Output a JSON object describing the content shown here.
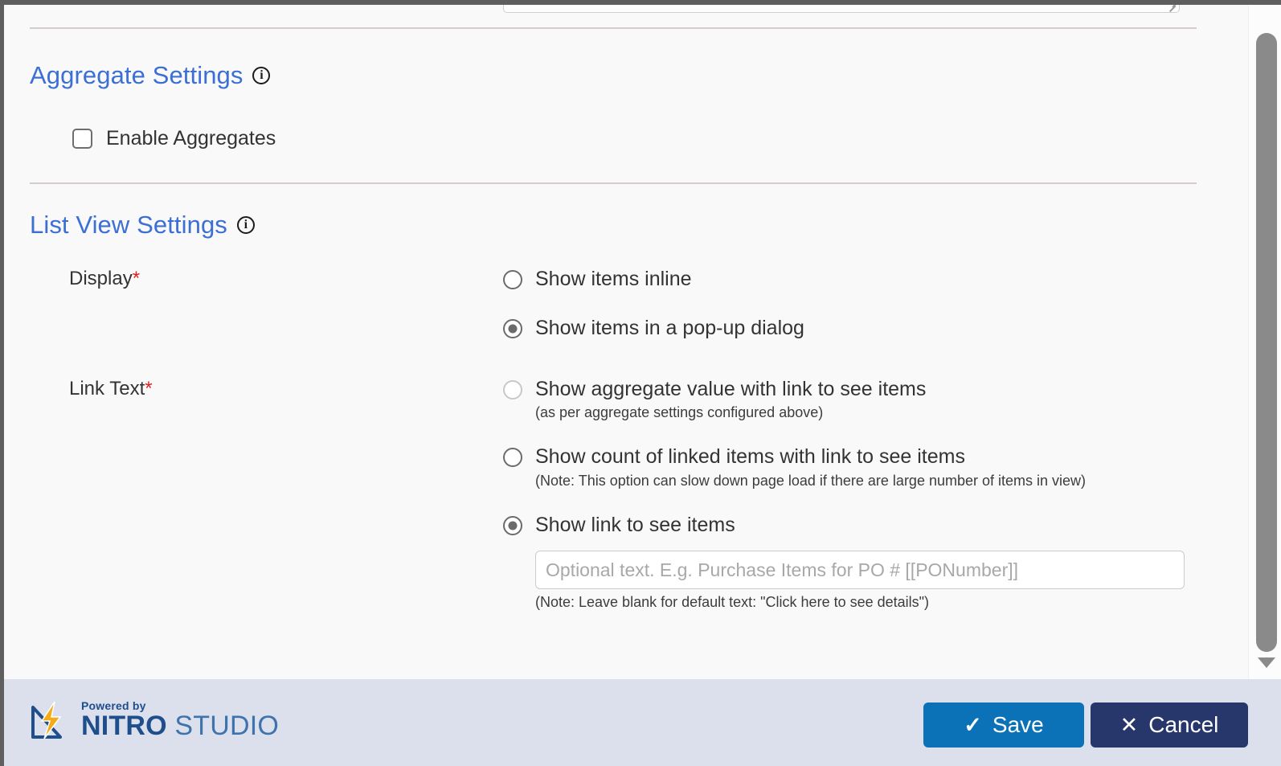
{
  "sections": {
    "aggregate": {
      "title": "Aggregate Settings",
      "info_icon": "info-icon",
      "enable_aggregates_label": "Enable Aggregates",
      "enable_aggregates_checked": false
    },
    "list_view": {
      "title": "List View Settings",
      "info_icon": "info-icon",
      "fields": {
        "display": {
          "label": "Display",
          "required_marker": "*",
          "options": [
            {
              "label": "Show items inline",
              "selected": false,
              "disabled": false
            },
            {
              "label": "Show items in a pop-up dialog",
              "selected": true,
              "disabled": false
            }
          ]
        },
        "link_text": {
          "label": "Link Text",
          "required_marker": "*",
          "options": [
            {
              "label": "Show aggregate value with link to see items",
              "hint": "(as per aggregate settings configured above)",
              "selected": false,
              "disabled": true
            },
            {
              "label": "Show count of linked items with link to see items",
              "hint": "(Note: This option can slow down page load if there are large number of items in view)",
              "selected": false,
              "disabled": false
            },
            {
              "label": "Show link to see items",
              "hint": "(Note: Leave blank for default text: \"Click here to see details\")",
              "selected": true,
              "disabled": false,
              "input": {
                "value": "",
                "placeholder": "Optional text. E.g. Purchase Items for PO # [[PONumber]]"
              }
            }
          ]
        }
      }
    }
  },
  "footer": {
    "logo": {
      "powered_by": "Powered by",
      "brand_bold": "NITRO",
      "brand_light": " STUDIO",
      "mark_icon": "nitro-lightning-logo"
    },
    "buttons": {
      "save": {
        "label": "Save",
        "icon": "check-icon",
        "color": "#0c72b8"
      },
      "cancel": {
        "label": "Cancel",
        "icon": "close-icon",
        "color": "#27366b"
      }
    }
  },
  "scrollbar": {
    "down_arrow_icon": "chevron-down-icon"
  }
}
